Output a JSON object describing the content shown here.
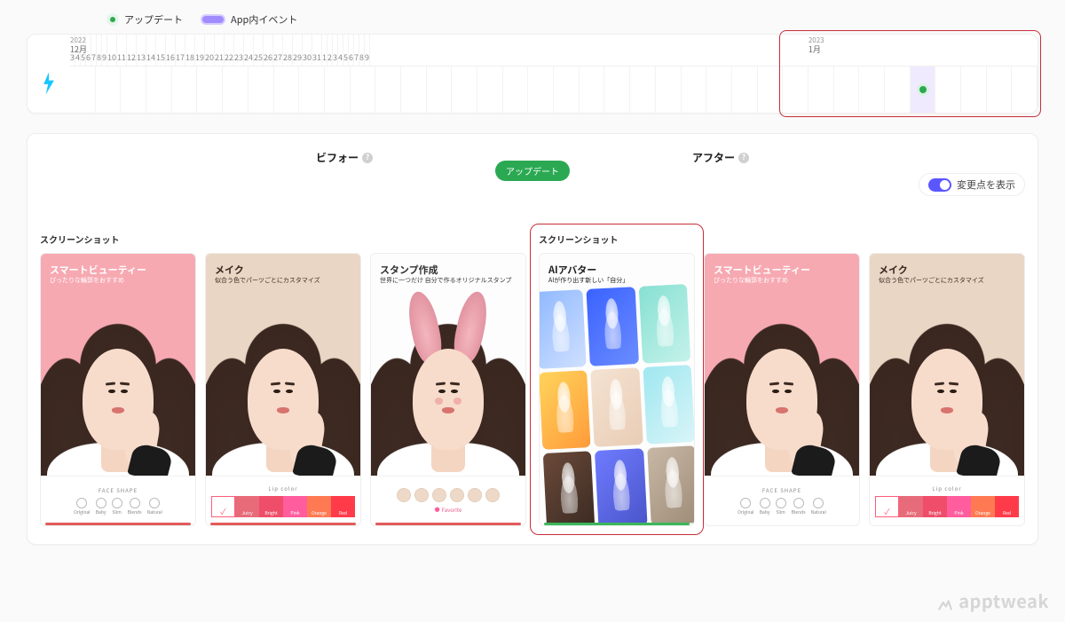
{
  "legend": {
    "update": "アップデート",
    "in_app_event": "App内イベント"
  },
  "timeline": {
    "months": [
      {
        "year": "2022",
        "label": "12月",
        "start_index": 0
      },
      {
        "year": "2023",
        "label": "1月",
        "start_index": 29
      }
    ],
    "days": [
      "3",
      "4",
      "5",
      "6",
      "7",
      "8",
      "9",
      "10",
      "11",
      "12",
      "13",
      "14",
      "15",
      "16",
      "17",
      "18",
      "19",
      "20",
      "21",
      "22",
      "23",
      "24",
      "25",
      "26",
      "27",
      "28",
      "29",
      "30",
      "31",
      "1",
      "2",
      "3",
      "4",
      "5",
      "6",
      "7",
      "8",
      "9"
    ],
    "band_index": 33,
    "update_index": 33
  },
  "compare": {
    "before_label": "ビフォー",
    "after_label": "アフター",
    "pill": "アップデート",
    "toggle_label": "変更点を表示"
  },
  "sections": {
    "screenshots": "スクリーンショット"
  },
  "before": [
    {
      "title": "スマートビューティー",
      "sub": "ぴったりな輪郭をおすすめ",
      "bg": "bg-pink",
      "text": "#fff",
      "footer": {
        "type": "circles",
        "label": "FACE SHAPE",
        "items": [
          "Original",
          "Baby",
          "Slim",
          "Blends",
          "Natural"
        ]
      },
      "status": "red"
    },
    {
      "title": "メイク",
      "sub": "似合う色でパーツごとにカスタマイズ",
      "bg": "bg-beige",
      "text": "#3a2a22",
      "footer": {
        "type": "swatches",
        "label": "Lip color",
        "items": [
          {
            "name": "",
            "color": "#ffffff",
            "selected": true
          },
          {
            "name": "Juicy",
            "color": "#e76b78"
          },
          {
            "name": "Bright",
            "color": "#ef4d6a"
          },
          {
            "name": "Pink",
            "color": "#ff5d9e"
          },
          {
            "name": "Orange",
            "color": "#ff7a52"
          },
          {
            "name": "Red",
            "color": "#ff3b4a"
          }
        ]
      },
      "status": "red"
    },
    {
      "title": "スタンプ作成",
      "sub": "世界に一つだけ\n自分で作るオリジナルスタンプ",
      "bg": "bg-white",
      "text": "#333",
      "footer": {
        "type": "avatars",
        "fav": "Favorite"
      },
      "status": "red",
      "ears": true,
      "blush": true
    }
  ],
  "after": [
    {
      "title": "AIアバター",
      "sub": "AIが作り出す新しい「自分」",
      "bg": "bg-white",
      "text": "#222",
      "footer": {
        "type": "none"
      },
      "status": "green",
      "collage": true
    },
    {
      "title": "スマートビューティー",
      "sub": "ぴったりな輪郭をおすすめ",
      "bg": "bg-pink",
      "text": "#fff",
      "footer": {
        "type": "circles",
        "label": "FACE SHAPE",
        "items": [
          "Original",
          "Baby",
          "Slim",
          "Blends",
          "Natural"
        ]
      },
      "status": "none"
    },
    {
      "title": "メイク",
      "sub": "似合う色でパーツごとにカスタマイズ",
      "bg": "bg-beige",
      "text": "#3a2a22",
      "footer": {
        "type": "swatches",
        "label": "Lip color",
        "items": [
          {
            "name": "",
            "color": "#ffffff",
            "selected": true
          },
          {
            "name": "Juicy",
            "color": "#e76b78"
          },
          {
            "name": "Bright",
            "color": "#ef4d6a"
          },
          {
            "name": "Pink",
            "color": "#ff5d9e"
          },
          {
            "name": "Orange",
            "color": "#ff7a52"
          },
          {
            "name": "Red",
            "color": "#ff3b4a"
          }
        ]
      },
      "status": "none"
    }
  ],
  "watermark": "apptweak"
}
